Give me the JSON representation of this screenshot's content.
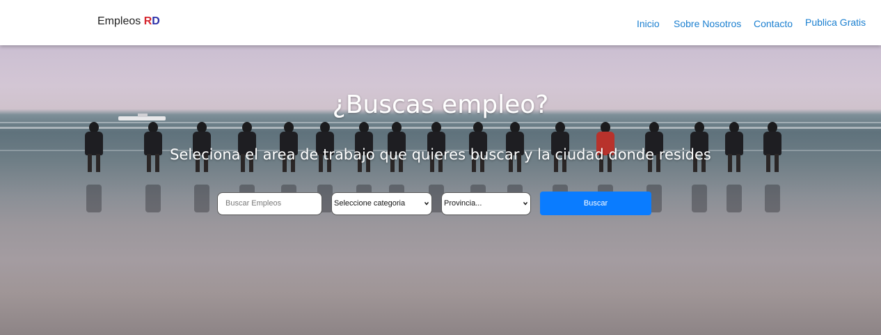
{
  "navbar": {
    "brand_text": "Empleos ",
    "brand_r": "R",
    "brand_d": "D",
    "links": [
      "Inicio",
      "Sobre Nosotros",
      "Contacto",
      "Publica Gratis"
    ]
  },
  "hero": {
    "title": "¿Buscas empleo?",
    "subtitle": "Seleciona el area de trabajo que quieres buscar y la ciudad donde resides"
  },
  "search": {
    "placeholder": "Buscar Empleos",
    "category_selected": "Seleccione categoria",
    "province_selected": "Provincia...",
    "button_label": "Buscar"
  },
  "colors": {
    "brand_r": "#d6262e",
    "brand_d": "#2b2fa8",
    "nav_link": "#1a7fd0",
    "button": "#0a7cff"
  }
}
